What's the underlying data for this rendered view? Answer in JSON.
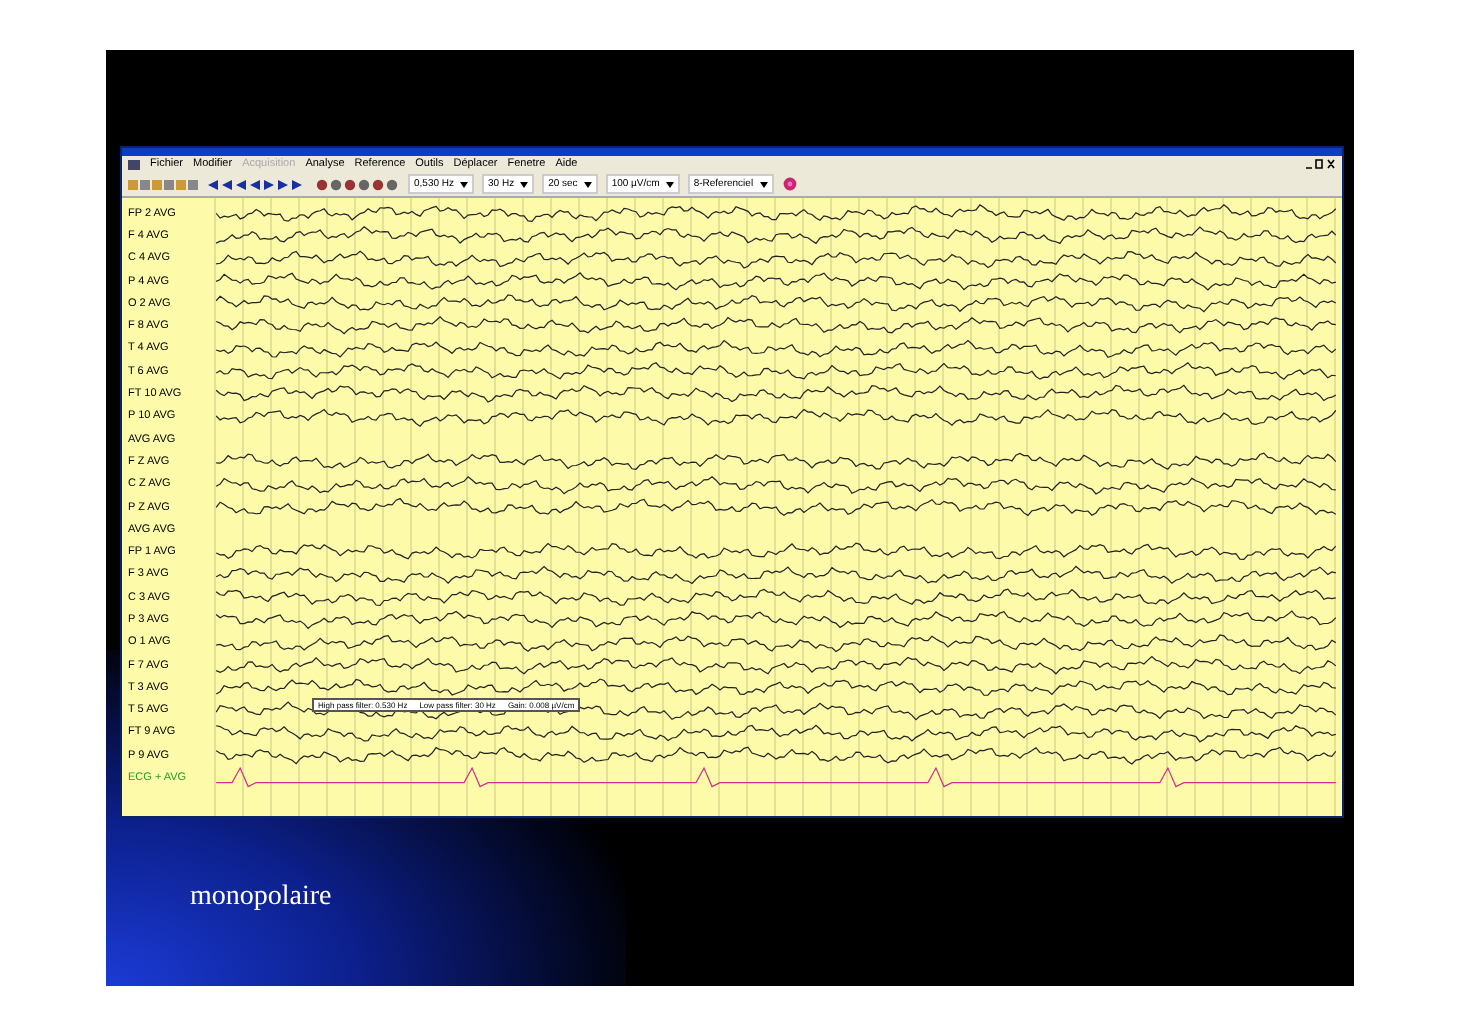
{
  "slide": {
    "caption": "monopolaire"
  },
  "window": {
    "menu": [
      {
        "label": "Fichier",
        "disabled": false
      },
      {
        "label": "Modifier",
        "disabled": false
      },
      {
        "label": "Acquisition",
        "disabled": true
      },
      {
        "label": "Analyse",
        "disabled": false
      },
      {
        "label": "Reference",
        "disabled": false
      },
      {
        "label": "Outils",
        "disabled": false
      },
      {
        "label": "Déplacer",
        "disabled": false
      },
      {
        "label": "Fenetre",
        "disabled": false
      },
      {
        "label": "Aide",
        "disabled": false
      }
    ],
    "dropdowns": [
      "0,530 Hz",
      "30 Hz",
      "20 sec",
      "100 µV/cm",
      "8-Referenciel"
    ],
    "channels": [
      {
        "label": "FP 2 AVG",
        "kind": "eeg"
      },
      {
        "label": "F 4 AVG",
        "kind": "eeg"
      },
      {
        "label": "C 4 AVG",
        "kind": "eeg"
      },
      {
        "label": "P 4 AVG",
        "kind": "eeg"
      },
      {
        "label": "O 2 AVG",
        "kind": "eeg"
      },
      {
        "label": "F 8 AVG",
        "kind": "eeg"
      },
      {
        "label": "T 4 AVG",
        "kind": "eeg"
      },
      {
        "label": "T 6 AVG",
        "kind": "eeg"
      },
      {
        "label": "FT 10 AVG",
        "kind": "eeg"
      },
      {
        "label": "P 10 AVG",
        "kind": "eeg"
      },
      {
        "label": "AVG AVG",
        "kind": "empty"
      },
      {
        "label": "F Z AVG",
        "kind": "eeg"
      },
      {
        "label": "C Z AVG",
        "kind": "eeg"
      },
      {
        "label": "P Z AVG",
        "kind": "eeg"
      },
      {
        "label": "AVG AVG",
        "kind": "empty"
      },
      {
        "label": "FP 1 AVG",
        "kind": "eeg"
      },
      {
        "label": "F 3 AVG",
        "kind": "eeg"
      },
      {
        "label": "C 3 AVG",
        "kind": "eeg"
      },
      {
        "label": "P 3 AVG",
        "kind": "eeg"
      },
      {
        "label": "O 1 AVG",
        "kind": "eeg"
      },
      {
        "label": "F 7 AVG",
        "kind": "eeg"
      },
      {
        "label": "T 3 AVG",
        "kind": "eeg"
      },
      {
        "label": "T 5 AVG",
        "kind": "eeg"
      },
      {
        "label": "FT 9 AVG",
        "kind": "eeg"
      },
      {
        "label": "P 9 AVG",
        "kind": "eeg"
      },
      {
        "label": "ECG + AVG",
        "kind": "ecg"
      }
    ],
    "tooltip": [
      "High pass filter: 0.530 Hz",
      "Low pass filter: 30 Hz",
      "Gain: 0.008 µV/cm"
    ]
  }
}
